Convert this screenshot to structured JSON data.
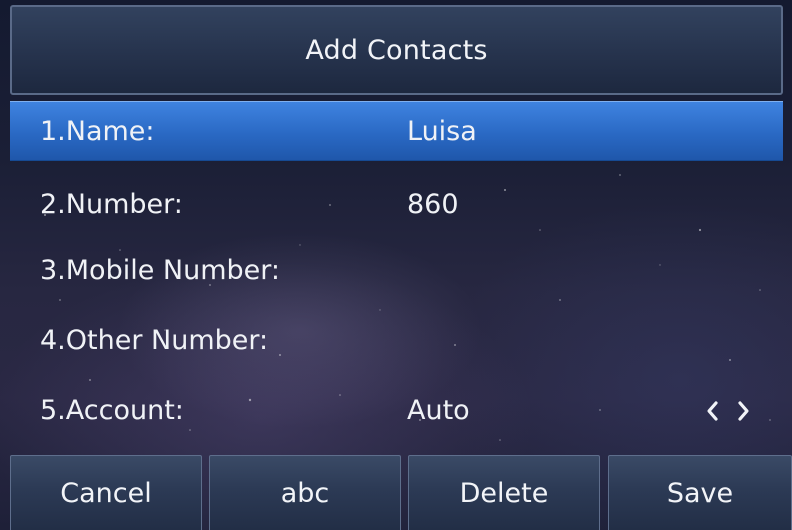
{
  "screen": {
    "title": "Add Contacts"
  },
  "fields": [
    {
      "label": "1.Name:",
      "value": "Luisa",
      "selected": true
    },
    {
      "label": "2.Number:",
      "value": "860",
      "selected": false
    },
    {
      "label": "3.Mobile Number:",
      "value": "",
      "selected": false
    },
    {
      "label": "4.Other Number:",
      "value": "",
      "selected": false
    },
    {
      "label": "5.Account:",
      "value": "Auto",
      "selected": false,
      "switcher": true
    }
  ],
  "softkeys": [
    {
      "label": "Cancel"
    },
    {
      "label": "abc"
    },
    {
      "label": "Delete"
    },
    {
      "label": "Save"
    }
  ],
  "icons": {
    "account_prev": "chevron-left-icon",
    "account_next": "chevron-right-icon"
  },
  "colors": {
    "selected_row": "#2f6fcc",
    "title_bar": "#2a3852",
    "softkey": "#2c3a55",
    "text": "#f2f4f8"
  }
}
